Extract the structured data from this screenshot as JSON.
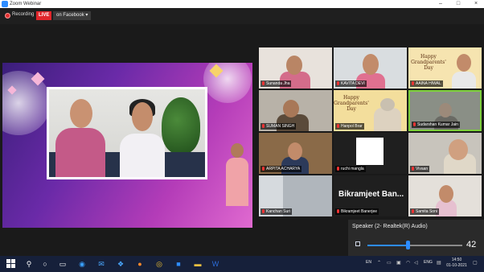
{
  "window": {
    "title": "Zoom Webinar"
  },
  "topbar": {
    "recording_label": "Recording",
    "live_badge": "LIVE",
    "facebook_label": "on Facebook ▾"
  },
  "participants": [
    {
      "name": "Sunanda Jha"
    },
    {
      "name": "KAVITA DEVI"
    },
    {
      "name": "AAINA HIWAL",
      "card": "Happy Grandparents' Day"
    },
    {
      "name": "SUMAN SINGH"
    },
    {
      "name": "Hanpol Brar",
      "card": "Happy Grandparents' Day"
    },
    {
      "name": "Sudarshan Kumar Jain",
      "active": true
    },
    {
      "name": "ARPITA ACHARYA"
    },
    {
      "name": "ruchi mangla"
    },
    {
      "name": "Vivaan"
    },
    {
      "name": "Kanchan Suri"
    },
    {
      "name": "Bikramjeet Banerjee",
      "display_name": "Bikramjeet Ban..."
    },
    {
      "name": "Samita Soni"
    }
  ],
  "audio": {
    "device_label": "Speaker (2- Realtek(R) Audio)",
    "volume": "42",
    "volume_fraction": 0.42
  },
  "taskbar": {
    "language": "ENG",
    "keyboard": "EN",
    "time": "14:50",
    "date": "01-10-2021"
  },
  "colors": {
    "live": "#e0262b",
    "active_speaker": "#7ccf3a",
    "accent": "#2d8cff"
  }
}
